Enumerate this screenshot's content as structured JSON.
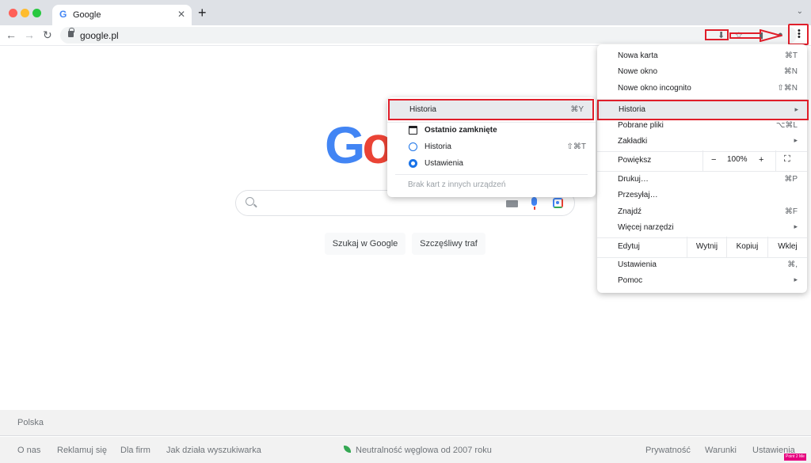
{
  "colors": {
    "accent": "#1a73e8",
    "annotation_red": "#e01e2a",
    "google_blue": "#4285f4",
    "google_red": "#ea4335"
  },
  "tab": {
    "title": "Google",
    "favicon": "G",
    "close": "✕"
  },
  "tabstrip": {
    "new_tab": "+",
    "chevron": "⌄"
  },
  "toolbar": {
    "url": "google.pl",
    "back": "←",
    "forward": "→",
    "reload": "↻",
    "kebab": "⋮"
  },
  "logo": {
    "text_blue": "G",
    "text_red": "o"
  },
  "search": {
    "button_search": "Szukaj w Google",
    "button_lucky": "Szczęśliwy traf"
  },
  "footer": {
    "country": "Polska",
    "links_left": [
      "O nas",
      "Reklamuj się",
      "Dla firm",
      "Jak działa wyszukiwarka"
    ],
    "carbon": "Neutralność węglowa od 2007 roku",
    "links_right": [
      "Prywatność",
      "Warunki",
      "Ustawienia"
    ]
  },
  "watermark": "Point 2 Me",
  "menu": {
    "new_tab": {
      "label": "Nowa karta",
      "shortcut": "⌘T"
    },
    "new_window": {
      "label": "Nowe okno",
      "shortcut": "⌘N"
    },
    "incognito": {
      "label": "Nowe okno incognito",
      "shortcut": "⇧⌘N"
    },
    "history": {
      "label": "Historia",
      "chevron": "▸"
    },
    "downloads": {
      "label": "Pobrane pliki",
      "shortcut": "⌥⌘L"
    },
    "bookmarks": {
      "label": "Zakładki",
      "chevron": "▸"
    },
    "zoom": {
      "label": "Powiększ",
      "minus": "−",
      "value": "100%",
      "plus": "+",
      "fullscreen": "⛶"
    },
    "print": {
      "label": "Drukuj…",
      "shortcut": "⌘P"
    },
    "cast": {
      "label": "Przesyłaj…"
    },
    "find": {
      "label": "Znajdź",
      "shortcut": "⌘F"
    },
    "more_tools": {
      "label": "Więcej narzędzi",
      "chevron": "▸"
    },
    "edit": {
      "label": "Edytuj",
      "cut": "Wytnij",
      "copy": "Kopiuj",
      "paste": "Wklej"
    },
    "settings": {
      "label": "Ustawienia",
      "shortcut": "⌘,"
    },
    "help": {
      "label": "Pomoc",
      "chevron": "▸"
    }
  },
  "submenu": {
    "history": {
      "label": "Historia",
      "shortcut": "⌘Y"
    },
    "recently_closed": {
      "label": "Ostatnio zamknięte"
    },
    "history_item": {
      "label": "Historia",
      "shortcut": "⇧⌘T"
    },
    "settings": {
      "label": "Ustawienia"
    },
    "no_tabs": {
      "label": "Brak kart z innych urządzeń"
    }
  }
}
